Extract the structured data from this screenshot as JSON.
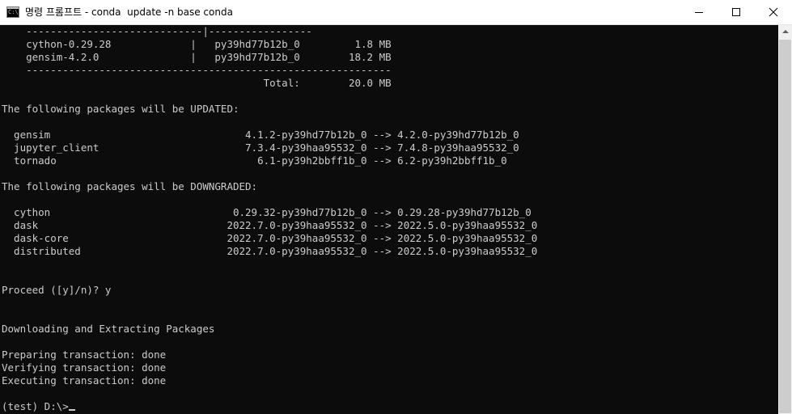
{
  "window": {
    "title": "명령 프롬프트 - conda  update -n base conda",
    "icon_label": "C:\\",
    "minimize_icon": "minimize-icon",
    "maximize_icon": "maximize-icon",
    "close_icon": "close-icon"
  },
  "console": {
    "lines": [
      "    -----------------------------|-----------------",
      "    cython-0.29.28             |   py39hd77b12b_0         1.8 MB",
      "    gensim-4.2.0               |   py39hd77b12b_0        18.2 MB",
      "    ------------------------------------------------------------",
      "                                           Total:        20.0 MB",
      "",
      "The following packages will be UPDATED:",
      "",
      "  gensim                                4.1.2-py39hd77b12b_0 --> 4.2.0-py39hd77b12b_0",
      "  jupyter_client                        7.3.4-py39haa95532_0 --> 7.4.8-py39haa95532_0",
      "  tornado                                 6.1-py39h2bbff1b_0 --> 6.2-py39h2bbff1b_0",
      "",
      "The following packages will be DOWNGRADED:",
      "",
      "  cython                              0.29.32-py39hd77b12b_0 --> 0.29.28-py39hd77b12b_0",
      "  dask                               2022.7.0-py39haa95532_0 --> 2022.5.0-py39haa95532_0",
      "  dask-core                          2022.7.0-py39haa95532_0 --> 2022.5.0-py39haa95532_0",
      "  distributed                        2022.7.0-py39haa95532_0 --> 2022.5.0-py39haa95532_0",
      "",
      "",
      "Proceed ([y]/n)? y",
      "",
      "",
      "Downloading and Extracting Packages",
      "",
      "Preparing transaction: done",
      "Verifying transaction: done",
      "Executing transaction: done",
      "",
      "(test) D:\\>"
    ]
  },
  "colors": {
    "console_bg": "#0c0c0c",
    "console_fg": "#cccccc",
    "titlebar_bg": "#ffffff"
  }
}
